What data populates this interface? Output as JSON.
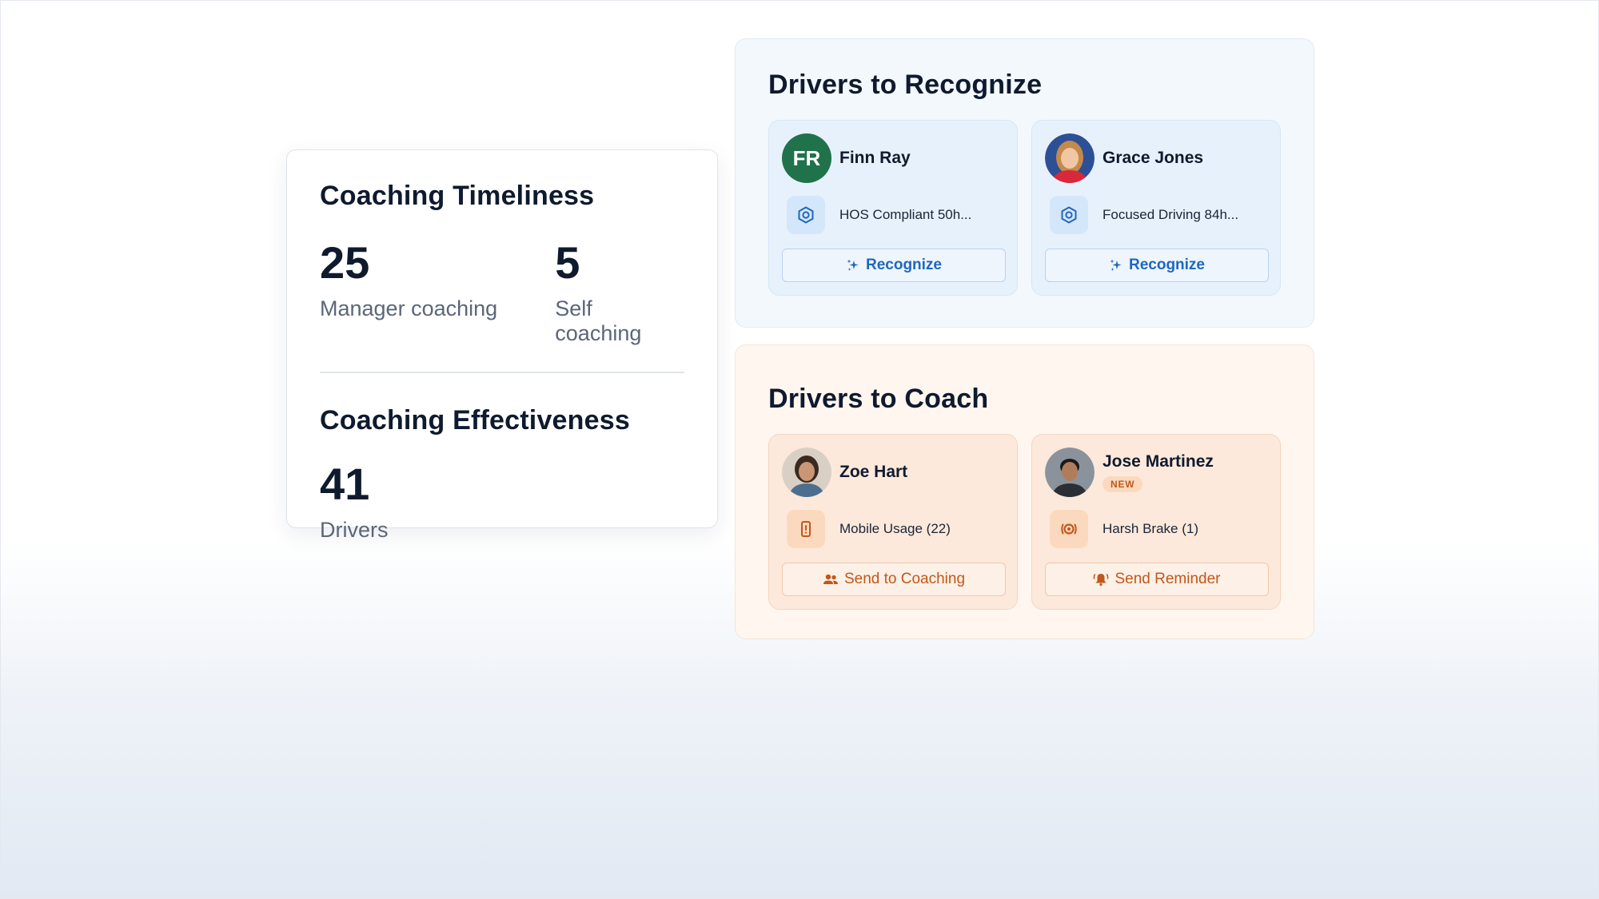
{
  "timeliness": {
    "title": "Coaching Timeliness",
    "manager_value": "25",
    "manager_label": "Manager coaching",
    "self_value": "5",
    "self_label": "Self coaching"
  },
  "effectiveness": {
    "title": "Coaching Effectiveness",
    "value": "41",
    "label": "Drivers"
  },
  "recognize": {
    "title": "Drivers to Recognize",
    "drivers": [
      {
        "name": "Finn Ray",
        "initials": "FR",
        "metric": "HOS Compliant 50h...",
        "action": "Recognize",
        "icon": "shield-check-icon"
      },
      {
        "name": "Grace Jones",
        "metric": "Focused Driving 84h...",
        "action": "Recognize",
        "icon": "shield-check-icon"
      }
    ]
  },
  "coach": {
    "title": "Drivers to Coach",
    "drivers": [
      {
        "name": "Zoe Hart",
        "metric": "Mobile Usage (22)",
        "action": "Send to Coaching",
        "icon": "mobile-alert-icon"
      },
      {
        "name": "Jose Martinez",
        "badge": "NEW",
        "metric": "Harsh Brake (1)",
        "action": "Send Reminder",
        "icon": "harsh-brake-icon"
      }
    ]
  },
  "colors": {
    "recognize_accent": "#1f67bf",
    "coach_accent": "#c2571a",
    "initials_avatar": "#20724a"
  }
}
